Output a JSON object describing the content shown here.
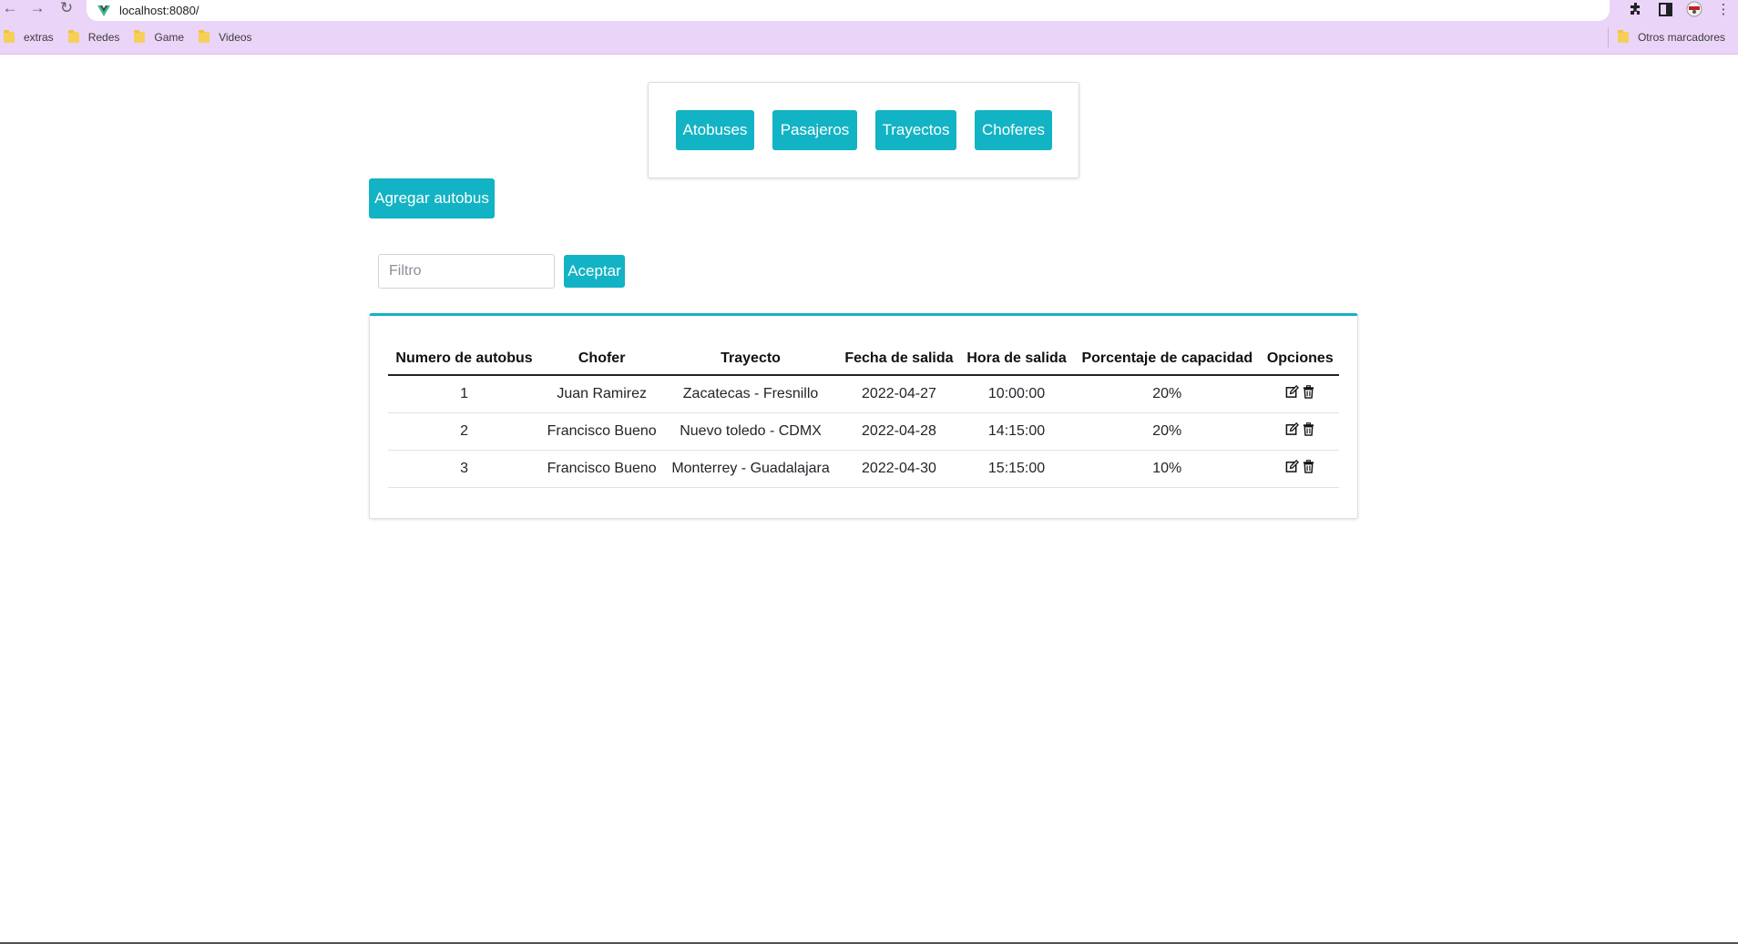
{
  "browser": {
    "url": "localhost:8080/",
    "bookmarks": [
      "extras",
      "Redes",
      "Game",
      "Videos"
    ],
    "other_bookmarks": "Otros marcadores"
  },
  "nav": {
    "buttons": [
      "Atobuses",
      "Pasajeros",
      "Trayectos",
      "Choferes"
    ]
  },
  "actions": {
    "add_label": "Agregar autobus",
    "filter_placeholder": "Filtro",
    "accept_label": "Aceptar"
  },
  "table": {
    "headers": [
      "Numero de autobus",
      "Chofer",
      "Trayecto",
      "Fecha de salida",
      "Hora de salida",
      "Porcentaje de capacidad",
      "Opciones"
    ],
    "rows": [
      [
        "1",
        "Juan Ramirez",
        "Zacatecas - Fresnillo",
        "2022-04-27",
        "10:00:00",
        "20%"
      ],
      [
        "2",
        "Francisco Bueno",
        "Nuevo toledo - CDMX",
        "2022-04-28",
        "14:15:00",
        "20%"
      ],
      [
        "3",
        "Francisco Bueno",
        "Monterrey - Guadalajara",
        "2022-04-30",
        "15:15:00",
        "10%"
      ]
    ]
  },
  "colors": {
    "accent": "#12b3c4",
    "chrome_bar": "#ead4f7"
  }
}
